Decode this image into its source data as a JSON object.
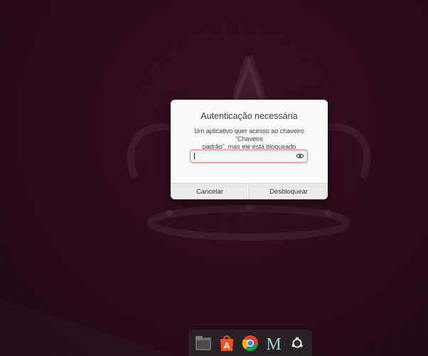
{
  "dialog": {
    "title": "Autenticação necessária",
    "message_line1": "Um aplicativo quer acesso ao chaveiro “Chaveiro",
    "message_line2": "padrão”, mas ele está bloqueado",
    "password_value": "",
    "cancel_label": "Cancelar",
    "unlock_label": "Desbloquear"
  },
  "dock": {
    "items": [
      {
        "name": "files",
        "icon": "file-manager-icon"
      },
      {
        "name": "app-store",
        "icon": "app-center-icon",
        "glyph": "A"
      },
      {
        "name": "browser",
        "icon": "chrome-icon"
      },
      {
        "name": "mail",
        "icon": "gmail-m-icon",
        "glyph": "M"
      },
      {
        "name": "apps",
        "icon": "ubuntu-logo-icon"
      }
    ]
  },
  "colors": {
    "background": "#2c0b1b",
    "field_border": "#e8875f",
    "dialog_bg": "#fafafa"
  }
}
